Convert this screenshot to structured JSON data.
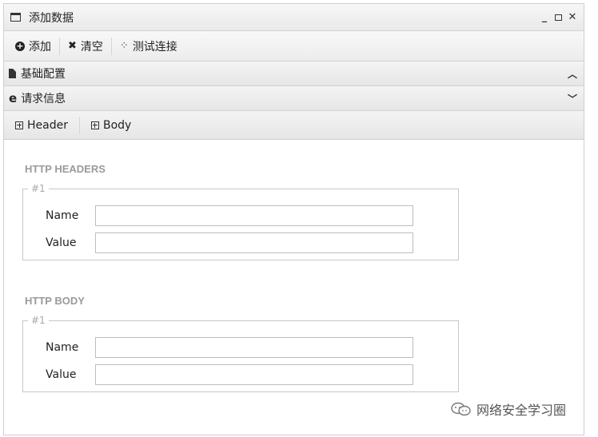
{
  "window": {
    "title": "添加数据",
    "icon": "window-icon"
  },
  "toolbar": {
    "add_label": "添加",
    "clear_label": "清空",
    "test_label": "测试连接"
  },
  "panels": {
    "basic_label": "基础配置",
    "request_label": "请求信息"
  },
  "subtabs": {
    "header_label": "Header",
    "body_label": "Body"
  },
  "headers_section": {
    "title": "HTTP HEADERS",
    "group_legend": "#1",
    "name_label": "Name",
    "value_label": "Value",
    "name_value": "",
    "value_value": ""
  },
  "body_section": {
    "title": "HTTP BODY",
    "group_legend": "#1",
    "name_label": "Name",
    "value_label": "Value",
    "name_value": "",
    "value_value": ""
  },
  "watermark": {
    "text": "网络安全学习圈"
  }
}
